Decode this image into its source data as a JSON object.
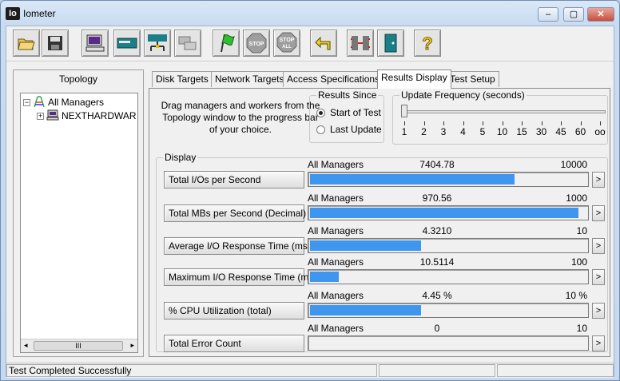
{
  "window": {
    "app_icon": "Io",
    "title": "Iometer",
    "min_icon": "minimize-icon",
    "max_icon": "maximize-icon",
    "close_icon": "close-icon"
  },
  "toolbar": {
    "buttons": [
      {
        "icon": "open-folder-icon"
      },
      {
        "icon": "save-disk-icon"
      },
      {
        "icon": "new-manager-icon"
      },
      {
        "icon": "new-disk-worker-icon"
      },
      {
        "icon": "new-network-worker-icon"
      },
      {
        "icon": "duplicate-worker-icon"
      },
      {
        "icon": "start-flag-icon"
      },
      {
        "icon": "stop-icon",
        "text": "STOP"
      },
      {
        "icon": "stop-all-icon",
        "text": "STOP",
        "subtext": "ALL"
      },
      {
        "icon": "reset-workers-icon"
      },
      {
        "icon": "disconnect-icon"
      },
      {
        "icon": "exit-door-icon"
      },
      {
        "icon": "help-icon",
        "text": "?"
      }
    ]
  },
  "topology": {
    "header": "Topology",
    "tree": [
      {
        "expander": "−",
        "icon": "managers-icon",
        "label": "All Managers"
      },
      {
        "expander": "+",
        "icon": "computer-icon",
        "label": "NEXTHARDWAR"
      }
    ],
    "scroll_left": "◂",
    "scroll_right": "▸",
    "scroll_thumb": "III"
  },
  "tabs": [
    {
      "label": "Disk Targets",
      "active": false
    },
    {
      "label": "Network Targets",
      "active": false
    },
    {
      "label": "Access Specifications",
      "active": false
    },
    {
      "label": "Results Display",
      "active": true
    },
    {
      "label": "Test Setup",
      "active": false
    }
  ],
  "results": {
    "instructions": "Drag managers and workers from the Topology window to the progress bar of your choice.",
    "results_since": {
      "label": "Results Since",
      "options": [
        {
          "label": "Start of Test",
          "selected": true
        },
        {
          "label": "Last Update",
          "selected": false
        }
      ]
    },
    "update_frequency": {
      "label": "Update Frequency (seconds)",
      "ticks": [
        "1",
        "2",
        "3",
        "4",
        "5",
        "10",
        "15",
        "30",
        "45",
        "60",
        "oo"
      ],
      "selected": "1"
    },
    "display_label": "Display",
    "metrics": [
      {
        "button": "Total I/Os per Second",
        "scope": "All Managers",
        "value": "7404.78",
        "max": "10000",
        "fill": 0.74,
        "arrow": ">"
      },
      {
        "button": "Total MBs per Second (Decimal)",
        "scope": "All Managers",
        "value": "970.56",
        "max": "1000",
        "fill": 0.971,
        "arrow": ">"
      },
      {
        "button": "Average I/O Response Time (ms)",
        "scope": "All Managers",
        "value": "4.3210",
        "max": "10",
        "fill": 0.402,
        "arrow": ">"
      },
      {
        "button": "Maximum I/O Response Time (ms)",
        "scope": "All Managers",
        "value": "10.5114",
        "max": "100",
        "fill": 0.105,
        "arrow": ">"
      },
      {
        "button": "% CPU Utilization (total)",
        "scope": "All Managers",
        "value": "4.45 %",
        "max": "10 %",
        "fill": 0.402,
        "arrow": ">"
      },
      {
        "button": "Total Error Count",
        "scope": "All Managers",
        "value": "0",
        "max": "10",
        "fill": 0,
        "arrow": ">"
      }
    ]
  },
  "status": {
    "message": "Test Completed Successfully"
  },
  "colors": {
    "bar": "#3e96ef"
  }
}
